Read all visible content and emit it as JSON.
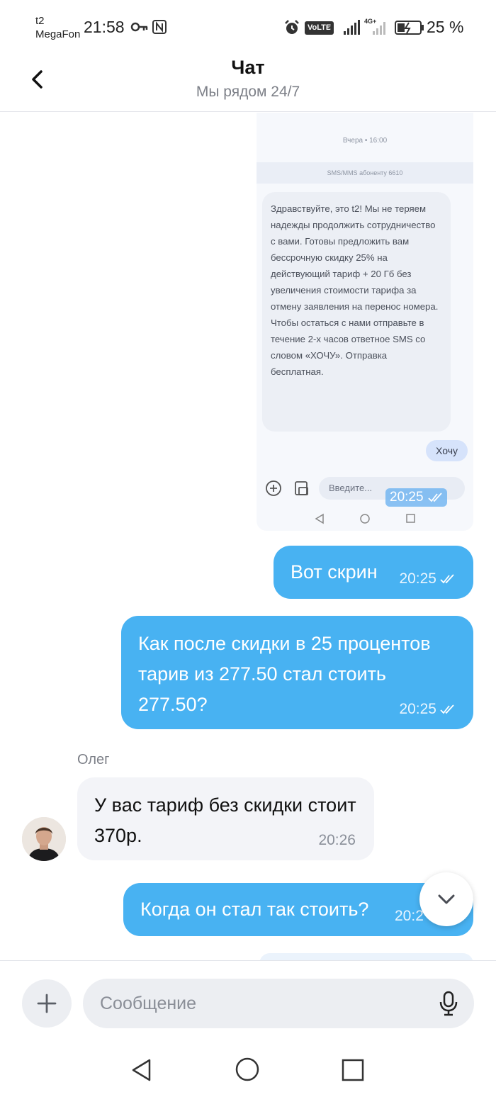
{
  "status_bar": {
    "carrier_top": "t2",
    "carrier_bottom": "MegaFon",
    "time": "21:58",
    "volte": "VoLTE",
    "sim_sub": "2",
    "network": "4G+",
    "battery": "25 %"
  },
  "header": {
    "title": "Чат",
    "subtitle": "Мы рядом 24/7"
  },
  "screenshot_image": {
    "date": "Вчера • 16:00",
    "band": "SMS/MMS абоненту 6610",
    "sms_text": "Здравствуйте, это t2! Мы не теряем надежды продолжить сотрудничество с вами. Готовы предложить вам бессрочную скидку 25% на действующий тариф + 20 Гб без увеличения стоимости тарифа за отмену заявления на перенос номера. Чтобы остаться с нами отправьте в течение 2-х часов ответное SMS со словом «ХОЧУ». Отправка бесплатная.",
    "reply": "Хочу",
    "input_placeholder": "Введите...",
    "time": "20:25"
  },
  "messages": [
    {
      "direction": "out",
      "text": "Вот скрин",
      "time": "20:25"
    },
    {
      "direction": "out",
      "text": "Как после скидки в 25 процентов тарив из 277.50 стал стоить 277.50?",
      "time": "20:25"
    },
    {
      "direction": "in",
      "sender": "Олег",
      "text": "У вас тариф без скидки стоит 370р.",
      "time": "20:26"
    },
    {
      "direction": "out",
      "text": "Когда он стал так стоить?",
      "time": "20:2"
    }
  ],
  "composer": {
    "placeholder": "Сообщение"
  },
  "colors": {
    "outgoing_bubble": "#48b2f2",
    "incoming_bubble": "#f3f4f8",
    "secondary_text": "#7d8088"
  }
}
